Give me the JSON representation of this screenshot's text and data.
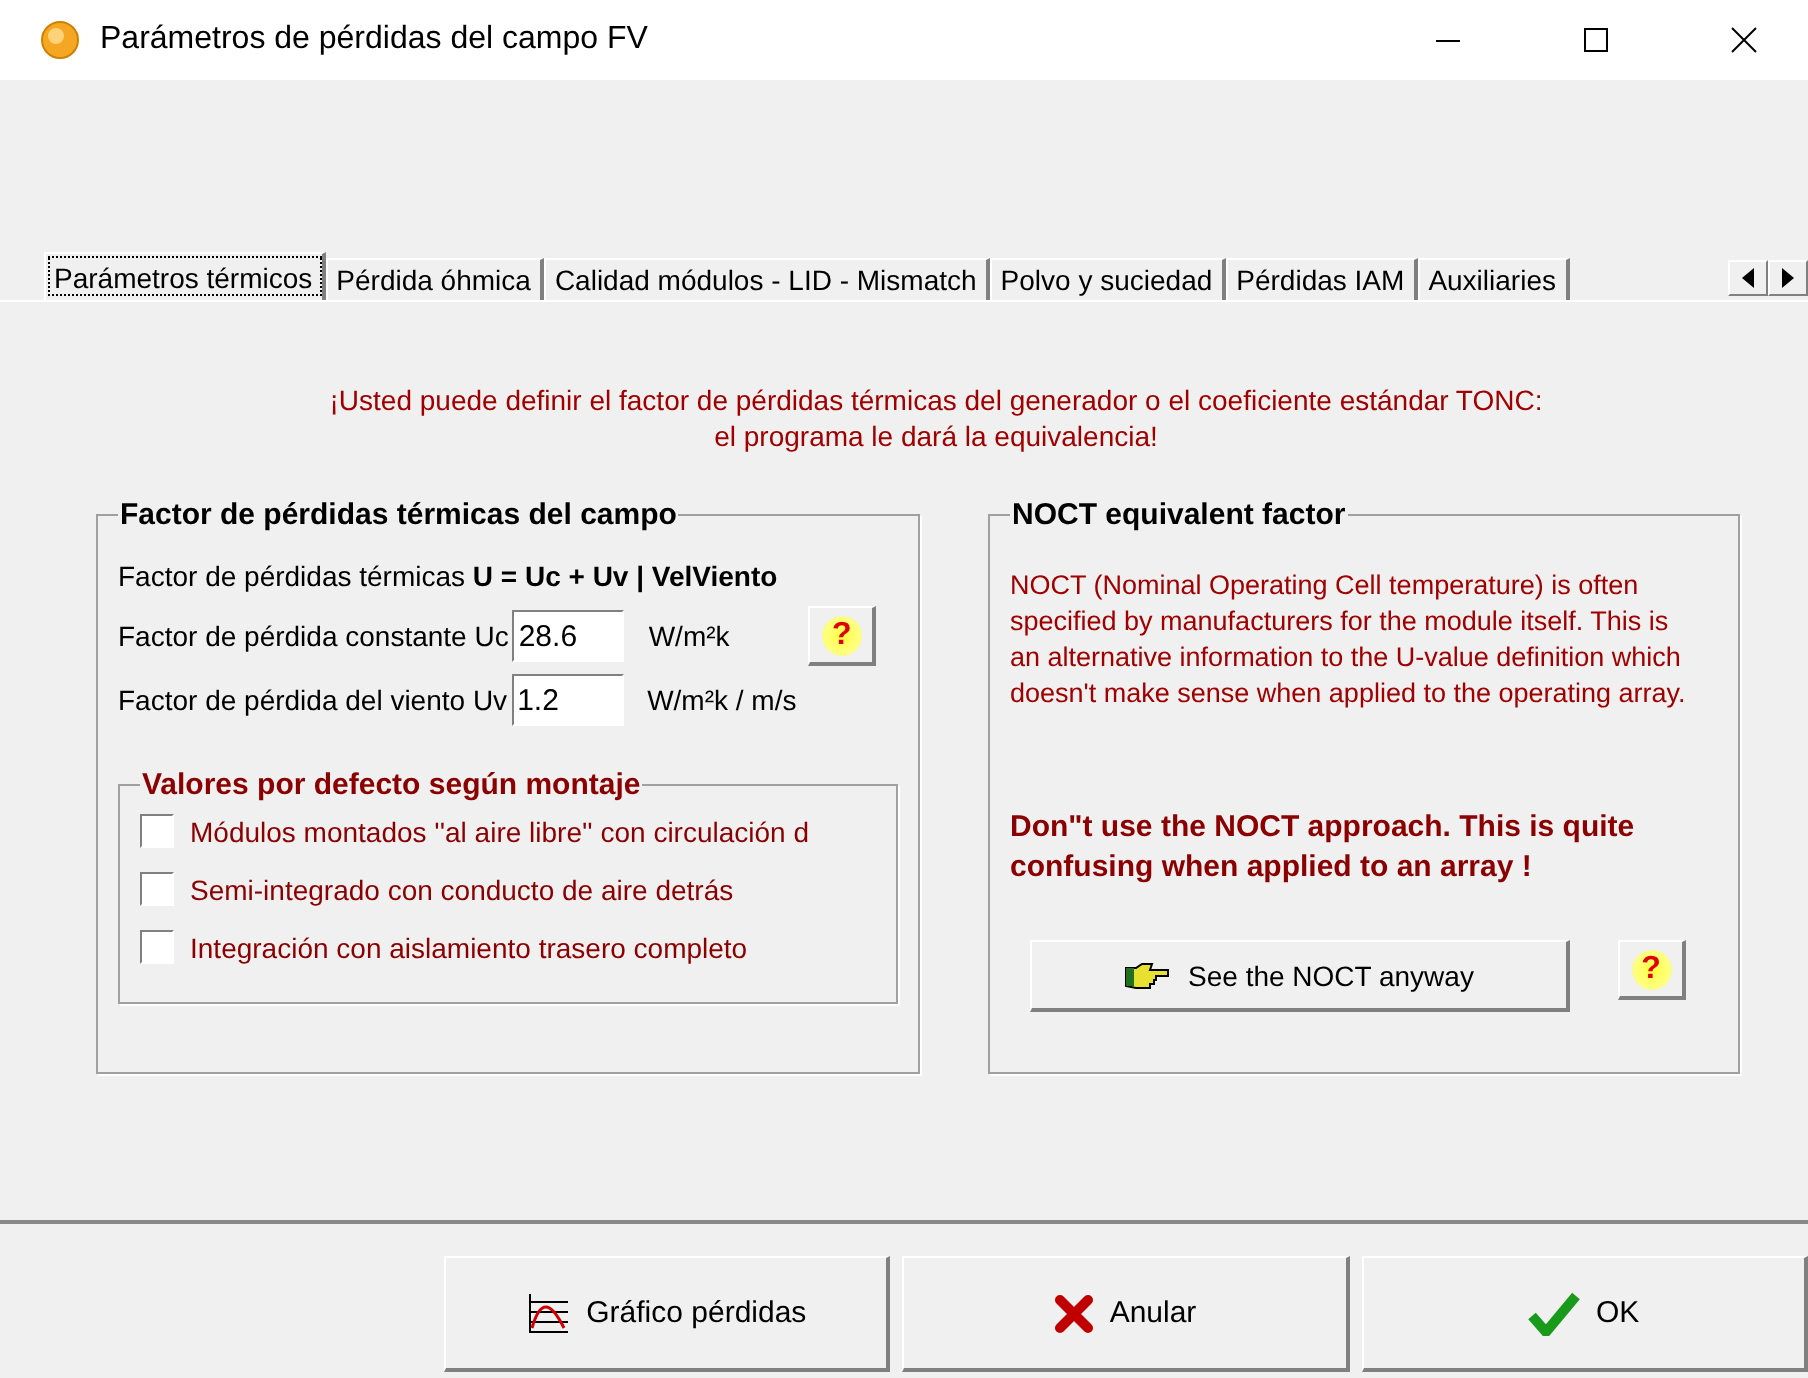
{
  "window": {
    "title": "Parámetros de pérdidas del campo FV"
  },
  "tabs": [
    {
      "label": "Parámetros térmicos",
      "selected": true
    },
    {
      "label": "Pérdida óhmica",
      "selected": false
    },
    {
      "label": "Calidad módulos - LID - Mismatch",
      "selected": false
    },
    {
      "label": "Polvo y suciedad",
      "selected": false
    },
    {
      "label": "Pérdidas IAM",
      "selected": false
    },
    {
      "label": "Auxiliaries",
      "selected": false
    }
  ],
  "info": [
    "¡Usted puede definir el factor de pérdidas térmicas del generador o el coeficiente estándar TONC:",
    "el programa le dará la equivalencia!"
  ],
  "thermal_group": {
    "title": "Factor de pérdidas térmicas del campo",
    "formula": "Factor de pérdidas térmicas **U = Uc + Uv | VelViento**",
    "fields": [
      {
        "label": "Factor de pérdida constante Uc",
        "value": "28.6",
        "unit": "W/m²k",
        "help": "?"
      },
      {
        "label": "Factor de pérdida del viento Uv",
        "value": "1.2",
        "unit": "W/m²k / m/s"
      }
    ],
    "defaults": {
      "title": "Valores por defecto según montaje",
      "options": [
        {
          "label": "Módulos montados ''al aire libre'' con circulación d",
          "checked": false
        },
        {
          "label": "Semi-integrado con conducto de aire detrás",
          "checked": false
        },
        {
          "label": "Integración con aislamiento trasero completo",
          "checked": false
        }
      ]
    }
  },
  "noct_group": {
    "title": "NOCT equivalent factor",
    "description": "NOCT  (Nominal Operating Cell temperature) is often specified by manufacturers  for the module itself. This is an alternative information to the U-value definition which doesn't make sense when applied to the operating array.",
    "warning": "Don\"t use the NOCT approach. This is quite confusing when applied to an array !",
    "button": "See the NOCT anyway",
    "help": "?"
  },
  "buttons": [
    {
      "kind": "chart",
      "label": "Gráfico pérdidas"
    },
    {
      "kind": "cancel",
      "label": "Anular"
    },
    {
      "kind": "ok",
      "label": "OK"
    }
  ]
}
